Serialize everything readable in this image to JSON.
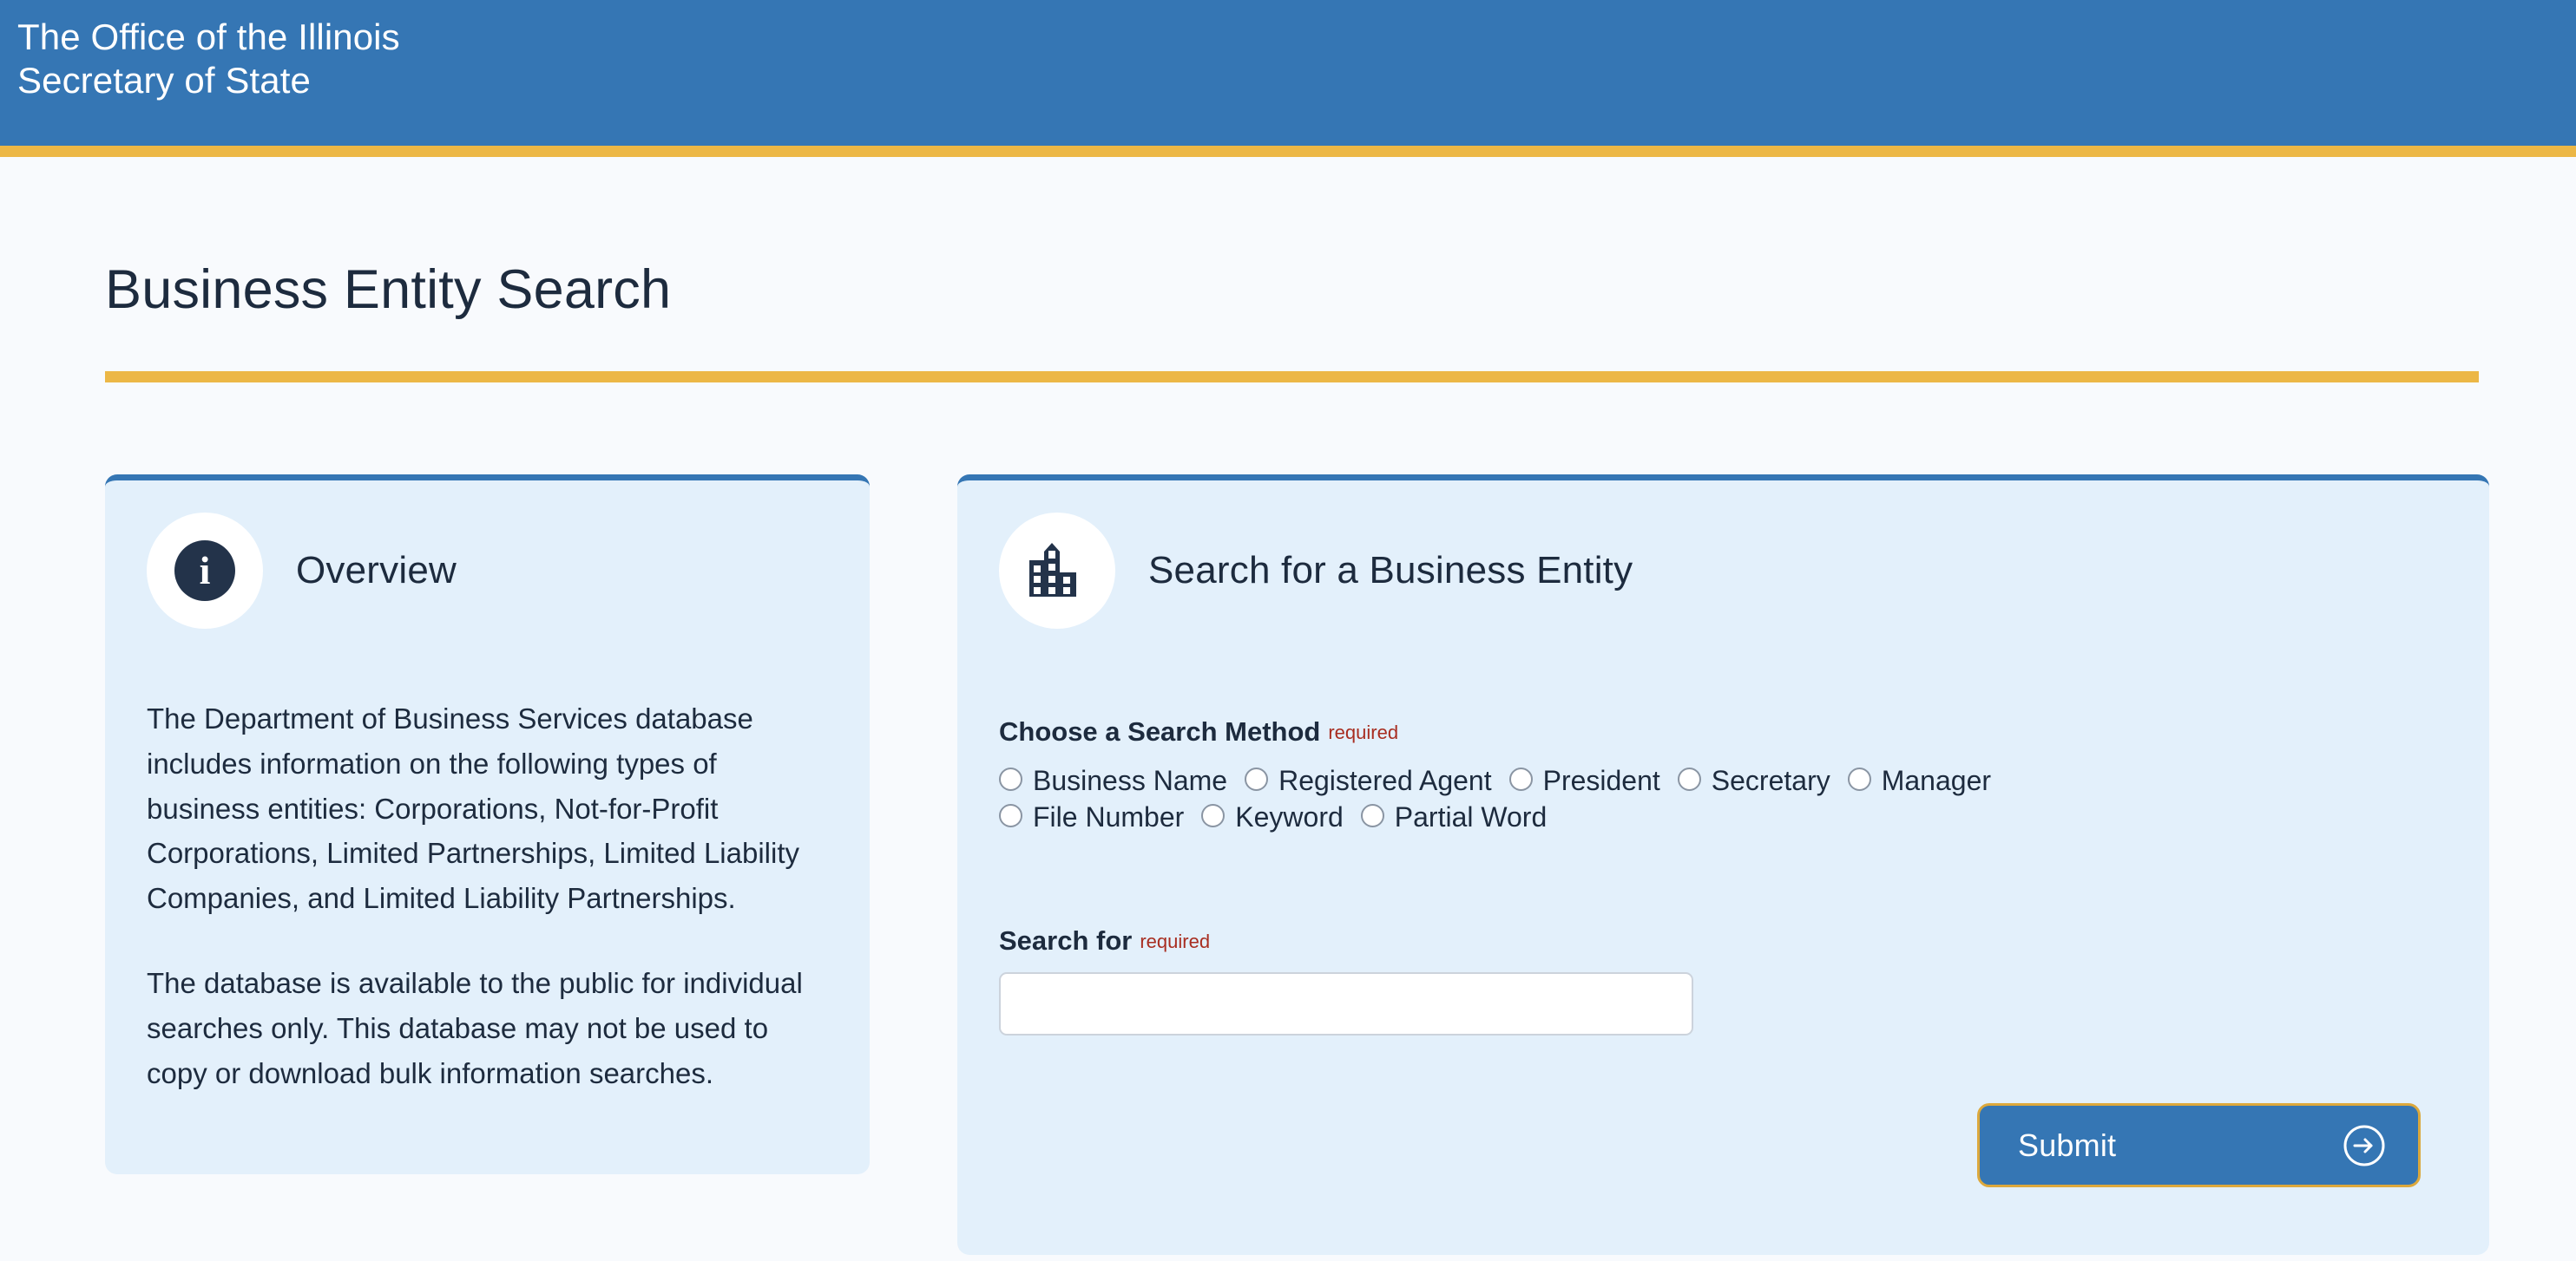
{
  "masthead": {
    "title": "The Office of the Illinois\nSecretary of State",
    "background_color": "#3576b4",
    "accent_color": "#ecb746"
  },
  "page": {
    "title": "Business Entity Search",
    "rule_color": "#ecb746",
    "background_color": "#f8fafd"
  },
  "overview_card": {
    "icon": "info-icon",
    "title": "Overview",
    "paragraphs": [
      "The Department of Business Services database includes information on the following types of business entities: Corporations, Not-for-Profit Corporations, Limited Partnerships, Limited Liability Companies, and Limited Liability Partnerships.",
      "The database is available to the public for individual searches only. This database may not be used to copy or download bulk information searches."
    ],
    "background_color": "#e3f0fb",
    "top_border_color": "#3576b4"
  },
  "search_card": {
    "icon": "building-icon",
    "title": "Search for a Business Entity",
    "background_color": "#e3f0fb",
    "top_border_color": "#3576b4",
    "search_method": {
      "label": "Choose a Search Method",
      "required_text": "required",
      "required_color": "#a82d20",
      "rows": [
        [
          {
            "label": "Business Name",
            "selected": false
          },
          {
            "label": "Registered Agent",
            "selected": false
          },
          {
            "label": "President",
            "selected": false
          },
          {
            "label": "Secretary",
            "selected": false
          },
          {
            "label": "Manager",
            "selected": false
          }
        ],
        [
          {
            "label": "File Number",
            "selected": false
          },
          {
            "label": "Keyword",
            "selected": false
          },
          {
            "label": "Partial Word",
            "selected": false
          }
        ]
      ]
    },
    "search_for": {
      "label": "Search for",
      "required_text": "required",
      "value": "",
      "placeholder": ""
    },
    "submit": {
      "label": "Submit",
      "icon": "arrow-right-circle-icon",
      "background_color": "#3576b4",
      "border_color": "#dca83c"
    }
  }
}
